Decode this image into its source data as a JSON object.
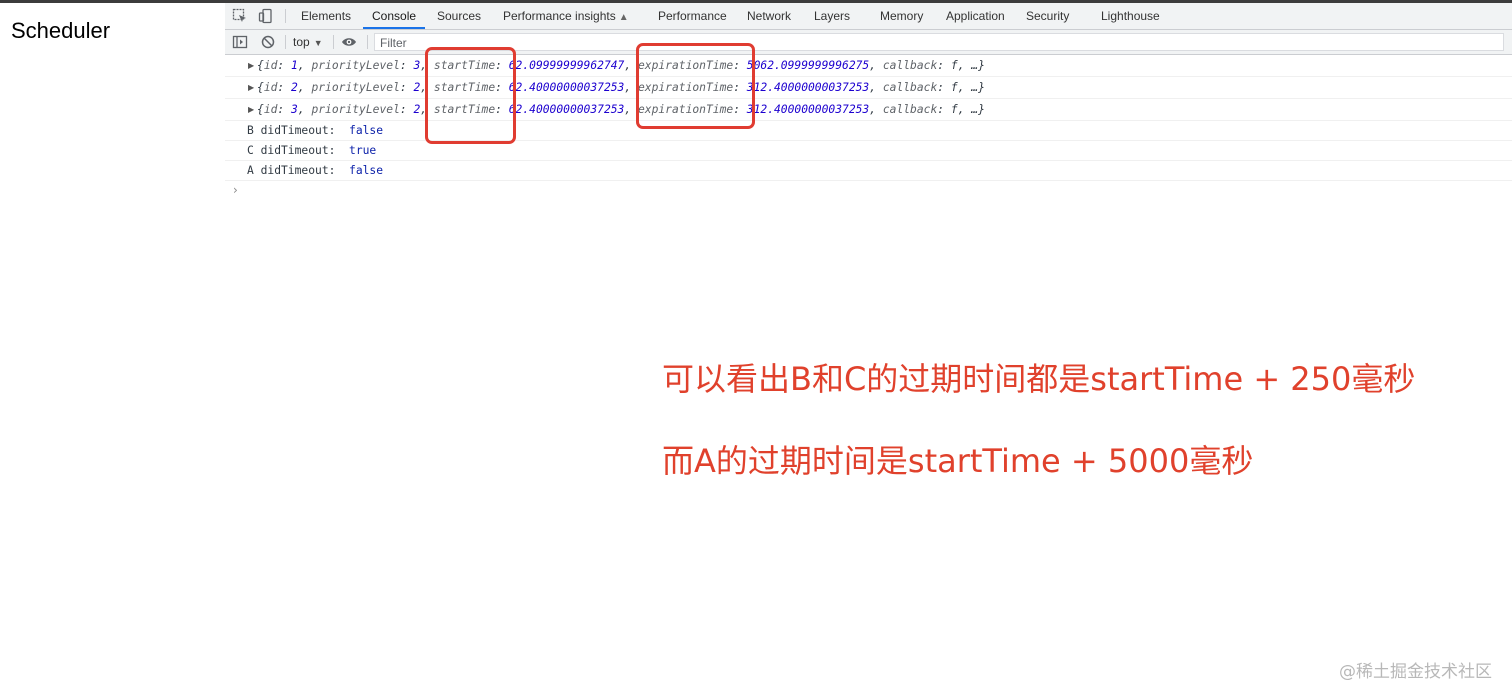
{
  "page": {
    "title": "Scheduler"
  },
  "devtools": {
    "tabs": [
      {
        "label": "Elements"
      },
      {
        "label": "Console",
        "active": true
      },
      {
        "label": "Sources"
      },
      {
        "label": "Performance insights"
      },
      {
        "label": "Performance"
      },
      {
        "label": "Network"
      },
      {
        "label": "Layers"
      },
      {
        "label": "Memory"
      },
      {
        "label": "Application"
      },
      {
        "label": "Security"
      },
      {
        "label": "Lighthouse"
      }
    ],
    "toolbar": {
      "context": "top",
      "filter_placeholder": "Filter"
    },
    "console": {
      "objects": [
        {
          "id_key": "id",
          "id": "1",
          "prio_key": "priorityLevel",
          "prio": "3",
          "start_key": "startTime",
          "start": "62.09999999962747",
          "exp_key": "expirationTime",
          "exp": "5062.0999999996275",
          "cb_key": "callback",
          "cb": "f",
          "rest": "…}"
        },
        {
          "id_key": "id",
          "id": "2",
          "prio_key": "priorityLevel",
          "prio": "2",
          "start_key": "startTime",
          "start": "62.40000000037253",
          "exp_key": "expirationTime",
          "exp": "312.40000000037253",
          "cb_key": "callback",
          "cb": "f",
          "rest": "…}"
        },
        {
          "id_key": "id",
          "id": "3",
          "prio_key": "priorityLevel",
          "prio": "2",
          "start_key": "startTime",
          "start": "62.40000000037253",
          "exp_key": "expirationTime",
          "exp": "312.40000000037253",
          "cb_key": "callback",
          "cb": "f",
          "rest": "…}"
        }
      ],
      "logs": [
        {
          "label": "B didTimeout:",
          "value": "false"
        },
        {
          "label": "C didTimeout:",
          "value": "true"
        },
        {
          "label": "A didTimeout:",
          "value": "false"
        }
      ],
      "prompt": "›"
    }
  },
  "annotations": {
    "line1": "可以看出B和C的过期时间都是startTime + 250毫秒",
    "line2": "而A的过期时间是startTime + 5000毫秒",
    "highlight_color": "#e03c31"
  },
  "watermark": "@稀土掘金技术社区"
}
